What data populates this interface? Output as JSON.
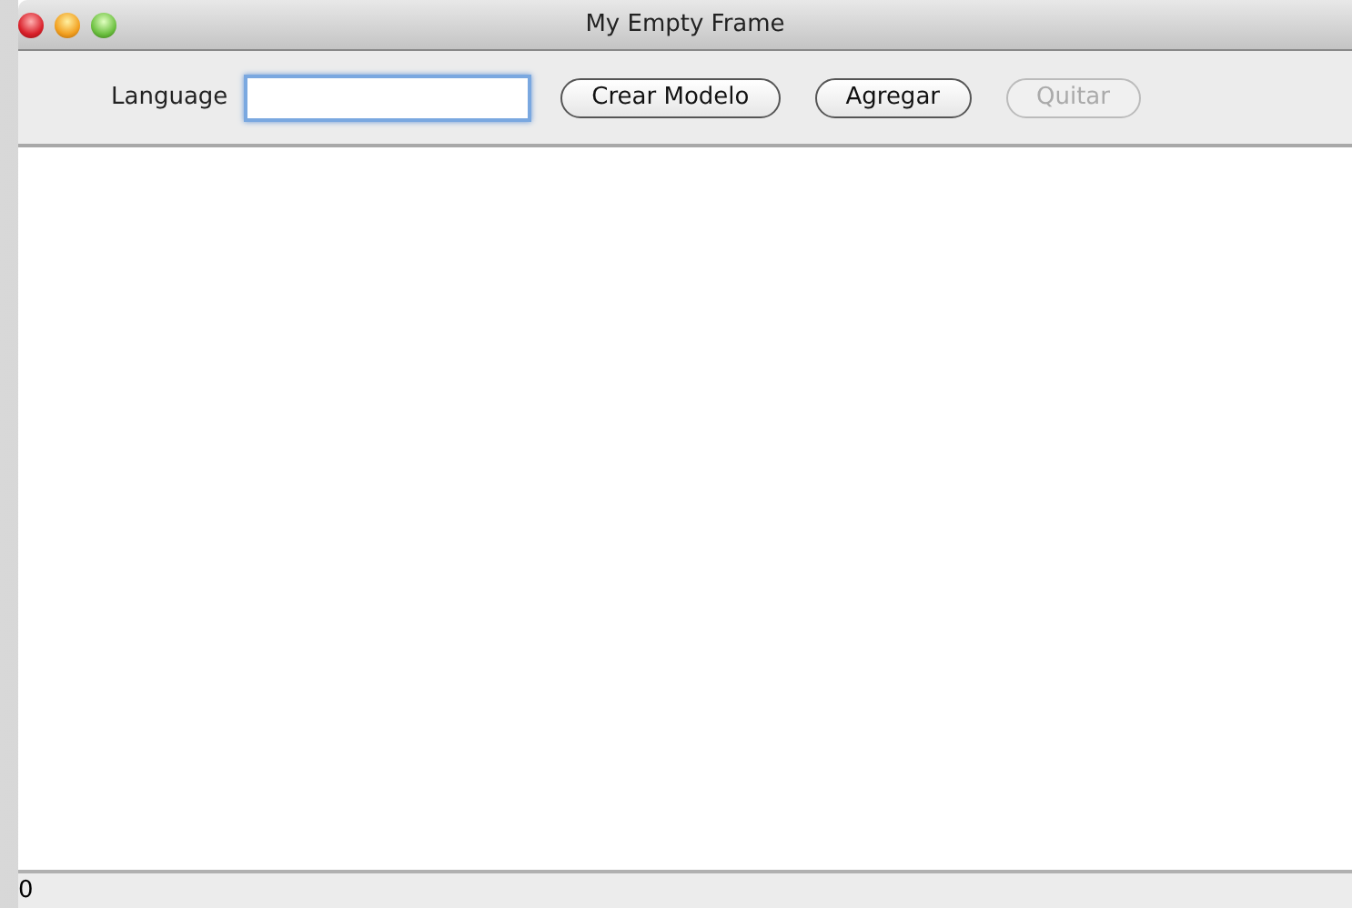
{
  "window": {
    "title": "My Empty Frame"
  },
  "toolbar": {
    "field": {
      "label": "Language",
      "focused": true
    },
    "buttons": [
      {
        "label": "Crear Modelo",
        "disabled": false
      },
      {
        "label": "Agregar",
        "disabled": false
      },
      {
        "label": "Quitar",
        "disabled": true
      }
    ]
  },
  "status_bar": {
    "text": "0"
  }
}
